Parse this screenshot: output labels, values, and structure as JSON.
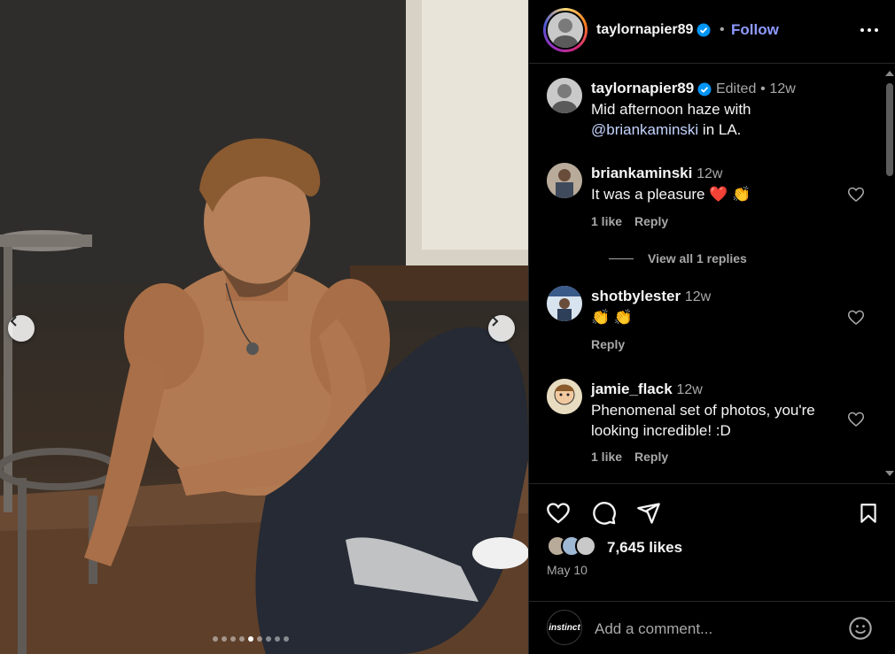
{
  "photo": {
    "carousel_dots": 9,
    "active_dot": 4,
    "prev_icon": "chevron-left-icon",
    "next_icon": "chevron-right-icon"
  },
  "header": {
    "username": "taylornapier89",
    "separator": "•",
    "follow_label": "Follow",
    "verified_color": "#0095f6"
  },
  "caption": {
    "username": "taylornapier89",
    "edited": "Edited",
    "dot": "•",
    "age": "12w",
    "text_line1": "Mid afternoon haze with",
    "mention": "@briankaminski",
    "text_after": " in LA."
  },
  "comments": [
    {
      "username": "briankaminski",
      "age": "12w",
      "text": "It was a pleasure ❤️ 👏",
      "likes": "1 like",
      "reply": "Reply",
      "view_replies": "View all 1 replies"
    },
    {
      "username": "shotbylester",
      "age": "12w",
      "text": "👏 👏",
      "reply": "Reply"
    },
    {
      "username": "jamie_flack",
      "age": "12w",
      "text": "Phenomenal set of photos, you're looking incredible! :D",
      "likes": "1 like",
      "reply": "Reply"
    }
  ],
  "actions": {
    "like_icon": "heart-icon",
    "comment_icon": "comment-icon",
    "share_icon": "share-icon",
    "save_icon": "bookmark-icon"
  },
  "likes_text": "7,645 likes",
  "date": "May 10",
  "comment_box": {
    "placeholder": "Add a comment...",
    "avatar_text": "instinct"
  },
  "colors": {
    "background": "#000000",
    "link": "#8f9bff",
    "muted": "#a8a8a8",
    "border": "#262626"
  }
}
